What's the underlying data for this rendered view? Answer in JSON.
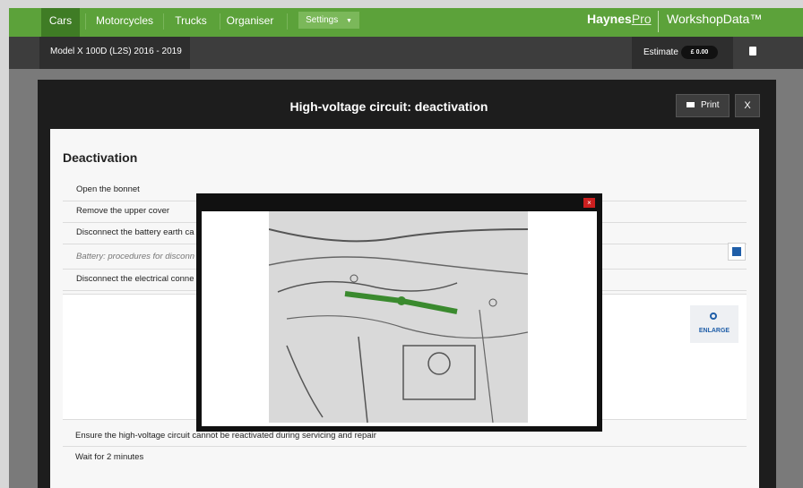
{
  "nav": {
    "items": [
      "Cars",
      "Motorcycles",
      "Trucks",
      "Organiser"
    ],
    "settings_label": "Settings",
    "brand_haynes": "Haynes",
    "brand_pro": "Pro",
    "brand_workshop": "WorkshopData™"
  },
  "subbar": {
    "model": "Model X 100D (L2S) 2016 - 2019",
    "estimate_label": "Estimate",
    "estimate_value": "£ 0.00"
  },
  "modal": {
    "title": "High-voltage circuit: deactivation",
    "print_label": "Print",
    "close_label": "X"
  },
  "content": {
    "section_title": "Deactivation",
    "steps": [
      "Open the bonnet",
      "Remove the upper cover",
      "Disconnect the battery earth ca",
      "Battery: procedures for disconn",
      "Disconnect the electrical conne"
    ],
    "enlarge_label": "ENLARGE",
    "bottom_steps": [
      "Ensure the high-voltage circuit cannot be reactivated during servicing and repair",
      "Wait for 2 minutes"
    ]
  },
  "popup": {
    "close_label": "×"
  },
  "colors": {
    "nav_green": "#5ca23a",
    "accent_blue": "#1f5ea8",
    "connector_green": "#3a8a2e"
  }
}
